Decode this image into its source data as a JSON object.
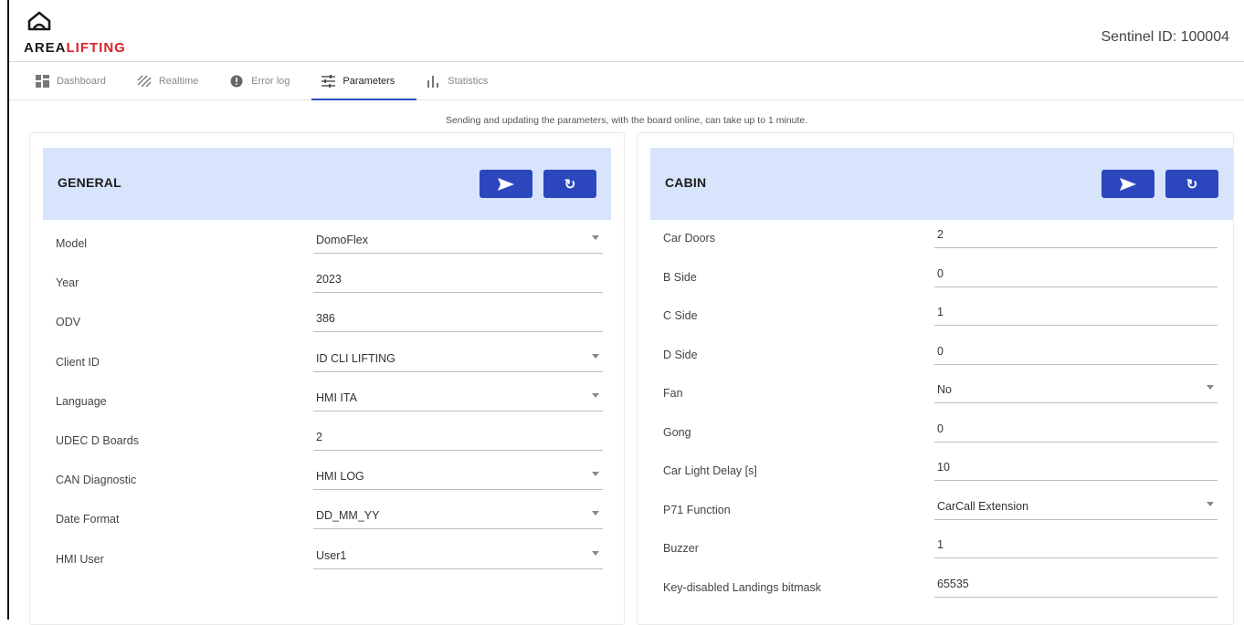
{
  "brand": {
    "area": "AREA",
    "lifting": "LIFTING"
  },
  "header": {
    "sentinel": "Sentinel ID: 100004"
  },
  "tabs": [
    {
      "label": "Dashboard",
      "icon": "dashboard-icon"
    },
    {
      "label": "Realtime",
      "icon": "realtime-icon"
    },
    {
      "label": "Error log",
      "icon": "error-icon"
    },
    {
      "label": "Parameters",
      "icon": "sliders-icon",
      "active": true
    },
    {
      "label": "Statistics",
      "icon": "bar-chart-icon"
    }
  ],
  "notice": "Sending and updating the parameters, with the board online, can take up to 1 minute.",
  "colors": {
    "accent": "#2c47be",
    "panel_head": "#d7e4fb",
    "brand_red": "#d8232a"
  },
  "general": {
    "title": "GENERAL",
    "rows": [
      {
        "label": "Model",
        "value": "DomoFlex",
        "dropdown": true
      },
      {
        "label": "Year",
        "value": "2023",
        "dropdown": false
      },
      {
        "label": "ODV",
        "value": "386",
        "dropdown": false
      },
      {
        "label": "Client ID",
        "value": "ID CLI LIFTING",
        "dropdown": true
      },
      {
        "label": "Language",
        "value": "HMI ITA",
        "dropdown": true
      },
      {
        "label": "UDEC D Boards",
        "value": "2",
        "dropdown": false
      },
      {
        "label": "CAN Diagnostic",
        "value": "HMI LOG",
        "dropdown": true
      },
      {
        "label": "Date Format",
        "value": "DD_MM_YY",
        "dropdown": true
      },
      {
        "label": "HMI User",
        "value": "User1",
        "dropdown": true
      }
    ]
  },
  "cabin": {
    "title": "CABIN",
    "rows": [
      {
        "label": "Car Doors",
        "value": "2",
        "dropdown": false
      },
      {
        "label": "B Side",
        "value": "0",
        "dropdown": false
      },
      {
        "label": "C Side",
        "value": "1",
        "dropdown": false
      },
      {
        "label": "D Side",
        "value": "0",
        "dropdown": false
      },
      {
        "label": "Fan",
        "value": "No",
        "dropdown": true
      },
      {
        "label": "Gong",
        "value": "0",
        "dropdown": false
      },
      {
        "label": "Car Light Delay [s]",
        "value": "10",
        "dropdown": false
      },
      {
        "label": "P71 Function",
        "value": "CarCall Extension",
        "dropdown": true
      },
      {
        "label": "Buzzer",
        "value": "1",
        "dropdown": false
      },
      {
        "label": "Key-disabled Landings bitmask",
        "value": "65535",
        "dropdown": false
      }
    ]
  }
}
